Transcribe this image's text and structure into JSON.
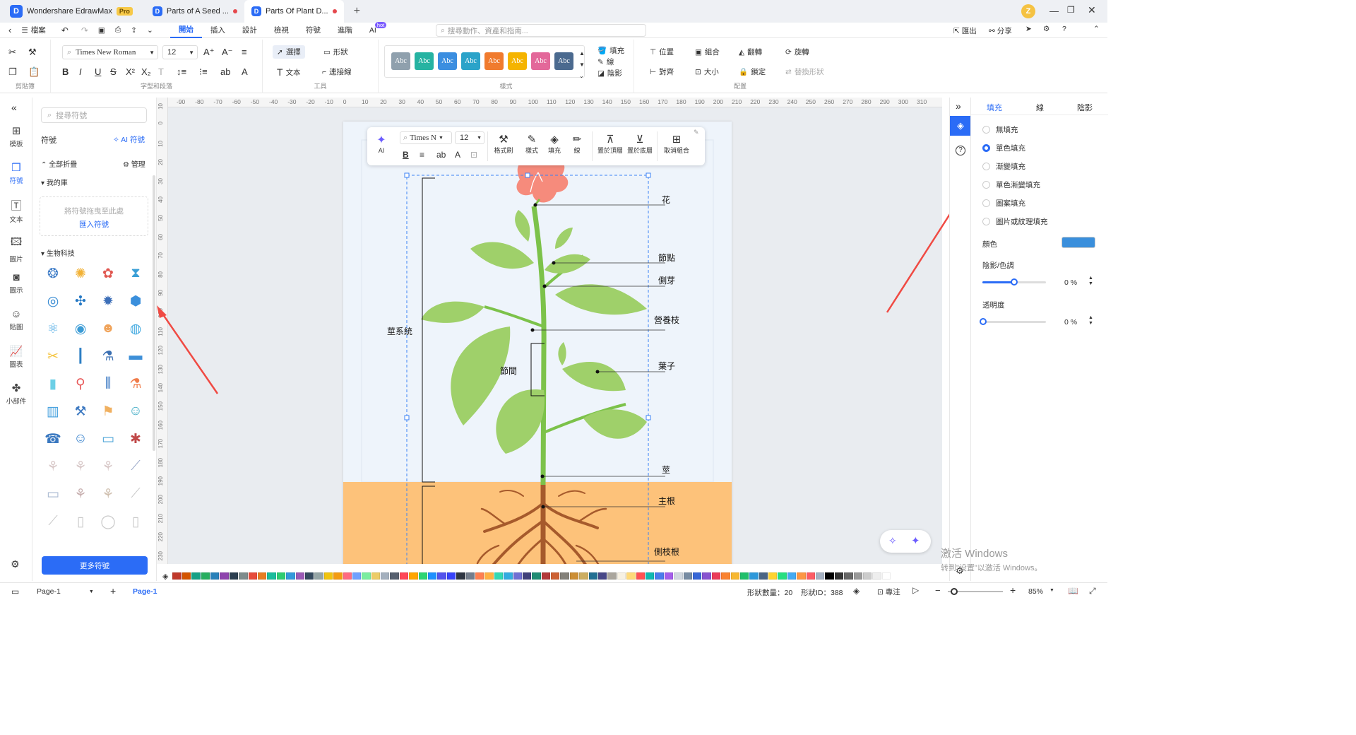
{
  "titlebar": {
    "app_name": "Wondershare EdrawMax",
    "pro_badge": "Pro",
    "tabs": [
      {
        "label": "Parts of A Seed ..."
      },
      {
        "label": "Parts Of Plant D..."
      }
    ],
    "user_initial": "Z"
  },
  "menubar": {
    "file": "檔案",
    "items": [
      "開始",
      "插入",
      "設計",
      "檢視",
      "符號",
      "進階",
      "AI"
    ],
    "ai_badge": "hot",
    "search_placeholder": "搜尋動作、資產和指南...",
    "export": "匯出",
    "share": "分享"
  },
  "ribbon": {
    "groups": {
      "clipboard": "剪貼簿",
      "font": "字型和段落",
      "tools": "工具",
      "style": "樣式",
      "arrange": "配置"
    },
    "font_name": "Times New Roman",
    "font_size": "12",
    "select": "選擇",
    "shape": "形狀",
    "text": "文本",
    "connector": "連接線",
    "fill": "填充",
    "line": "線",
    "shadow": "陰影",
    "swatch_text": "Abc",
    "swatches": [
      "#8fa0ad",
      "#26b3a2",
      "#3b8ee0",
      "#2ba3c9",
      "#f07b2e",
      "#f5b400",
      "#e3689a",
      "#4b6a8f"
    ],
    "position": "位置",
    "group": "組合",
    "flip": "翻轉",
    "rotate": "旋轉",
    "align": "對齊",
    "size": "大小",
    "lock": "鎖定",
    "replace_shape": "替換形狀"
  },
  "rail": [
    "模板",
    "符號",
    "文本",
    "圖片",
    "圖示",
    "貼圖",
    "圖表",
    "小部件"
  ],
  "symbols": {
    "search_placeholder": "搜尋符號",
    "title": "符號",
    "ai_symbol": "AI 符號",
    "collapse_all": "全部折疊",
    "manage": "管理",
    "my_library": "我的庫",
    "drop_hint": "將符號拖曳至此處",
    "import": "匯入符號",
    "category": "生物科技",
    "more": "更多符號"
  },
  "ruler": {
    "h": [
      "-90",
      "-80",
      "-70",
      "-60",
      "-50",
      "-40",
      "-30",
      "-20",
      "-10",
      "0",
      "10",
      "20",
      "30",
      "40",
      "50",
      "60",
      "70",
      "80",
      "90",
      "100",
      "110",
      "120",
      "130",
      "140",
      "150",
      "160",
      "170",
      "180",
      "190",
      "200",
      "210",
      "220",
      "230",
      "240",
      "250",
      "260",
      "270",
      "280",
      "290",
      "300",
      "310"
    ],
    "v": [
      "10",
      "0",
      "10",
      "20",
      "30",
      "40",
      "50",
      "60",
      "70",
      "80",
      "90",
      "100",
      "110",
      "120",
      "130",
      "140",
      "150",
      "160",
      "170",
      "180",
      "190",
      "200",
      "210",
      "220",
      "230"
    ]
  },
  "floatbar": {
    "ai": "AI",
    "font": "Times N",
    "size": "12",
    "format_painter": "格式刷",
    "style": "樣式",
    "fill": "填充",
    "line": "線",
    "bring_front": "置於頂層",
    "send_back": "置於底層",
    "ungroup": "取消組合"
  },
  "diagram": {
    "labels": {
      "flower": "花",
      "node": "節點",
      "lateral_bud": "側芽",
      "vegetative_branch": "營養枝",
      "leaf": "葉子",
      "internode": "節間",
      "stem_system": "莖系統",
      "stem": "莖",
      "main_root": "主根",
      "lateral_root": "側枝根"
    }
  },
  "rpanel": {
    "tabs": [
      "填充",
      "線",
      "陰影"
    ],
    "options": [
      "無填充",
      "單色填充",
      "漸變填充",
      "單色漸變填充",
      "圖案填充",
      "圖片或紋理填充"
    ],
    "selected_option": 1,
    "color_label": "顏色",
    "color_value": "#3a8fdc",
    "shade_label": "陰影/色調",
    "shade_value": "0 %",
    "transparency_label": "透明度",
    "transparency_value": "0 %"
  },
  "watermark": {
    "line1": "激活 Windows",
    "line2": "转到\"设置\"以激活 Windows。"
  },
  "statusbar": {
    "page_select": "Page-1",
    "page_tab": "Page-1",
    "shape_count": "形狀數量：20",
    "shape_id": "形狀ID：388",
    "focus": "專注",
    "zoom": "85%"
  }
}
